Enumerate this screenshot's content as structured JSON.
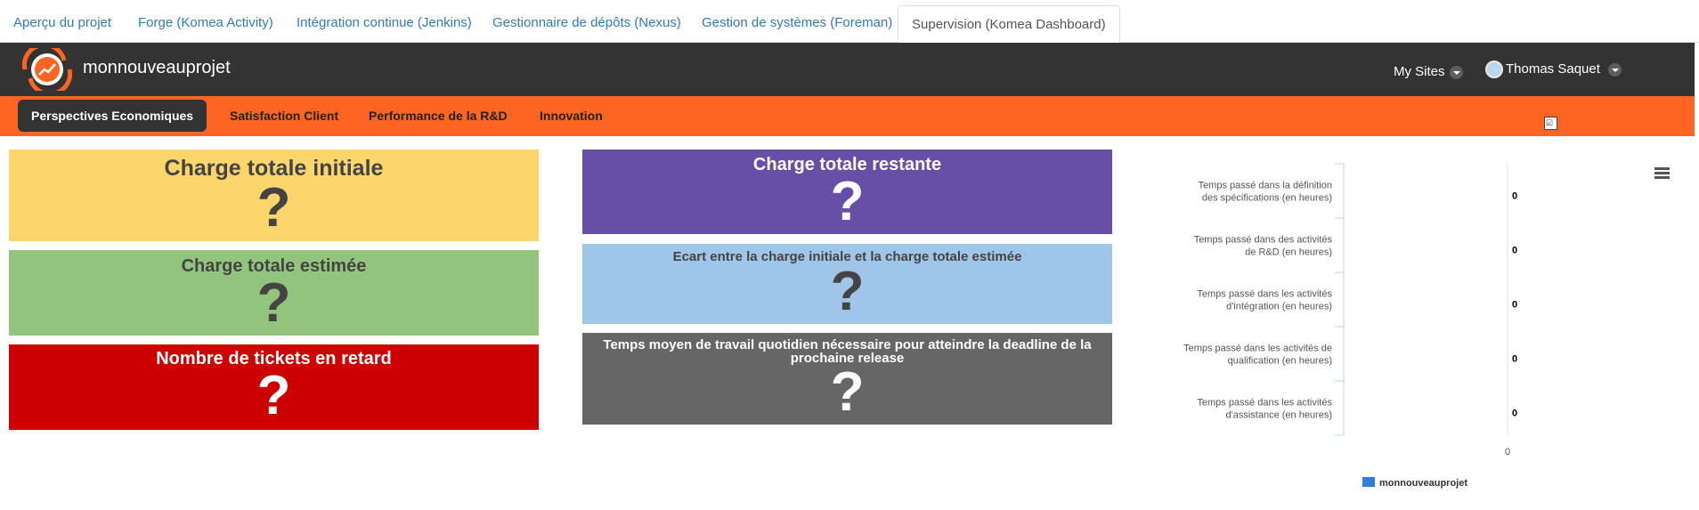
{
  "tabs": [
    {
      "label": "Aperçu du projet"
    },
    {
      "label": "Forge (Komea Activity)"
    },
    {
      "label": "Intégration continue (Jenkins)"
    },
    {
      "label": "Gestionnaire de dépôts (Nexus)"
    },
    {
      "label": "Gestion de systèmes (Foreman)"
    },
    {
      "label": "Supervision (Komea Dashboard)",
      "active": true
    }
  ],
  "header": {
    "site_title": "monnouveauprojet",
    "my_sites_label": "My Sites",
    "user_name": "Thomas Saquet"
  },
  "nav": {
    "items": [
      {
        "label": "Perspectives Economiques",
        "active": true
      },
      {
        "label": "Satisfaction Client"
      },
      {
        "label": "Performance de la R&D"
      },
      {
        "label": "Innovation"
      }
    ]
  },
  "tiles": {
    "charge_initiale": {
      "title": "Charge totale initiale",
      "value": "?",
      "color": "#fdd66b"
    },
    "charge_estimee": {
      "title": "Charge totale estimée",
      "value": "?",
      "color": "#93c47d"
    },
    "tickets_retard": {
      "title": "Nombre de tickets en retard",
      "value": "?",
      "color": "#cc0000"
    },
    "charge_restante": {
      "title": "Charge totale restante",
      "value": "?",
      "color": "#674ea7"
    },
    "ecart": {
      "title": "Ecart entre la charge initiale et la charge totale estimée",
      "value": "?",
      "color": "#9fc5e8"
    },
    "temps_moyen": {
      "title": "Temps moyen de travail quotidien nécessaire pour atteindre la deadline de la prochaine release",
      "value": "?",
      "color": "#666666"
    }
  },
  "chart_data": {
    "type": "bar",
    "orientation": "horizontal",
    "categories": [
      [
        "Temps passé dans la définition",
        "des spécifications (en heures)"
      ],
      [
        "Temps passé dans des activités",
        "de R&D (en heures)"
      ],
      [
        "Temps passé dans les activités",
        "d'intégration (en heures)"
      ],
      [
        "Temps passé dans les activités de",
        "qualification (en heures)"
      ],
      [
        "Temps passé dans les activités",
        "d'assistance (en heures)"
      ]
    ],
    "series": [
      {
        "name": "monnouveauprojet",
        "values": [
          0,
          0,
          0,
          0,
          0
        ],
        "color": "#2f7ed8"
      }
    ],
    "value_axis_ticks": [
      "0"
    ],
    "data_labels": [
      "0",
      "0",
      "0",
      "0",
      "0"
    ],
    "legend_position": "bottom"
  }
}
